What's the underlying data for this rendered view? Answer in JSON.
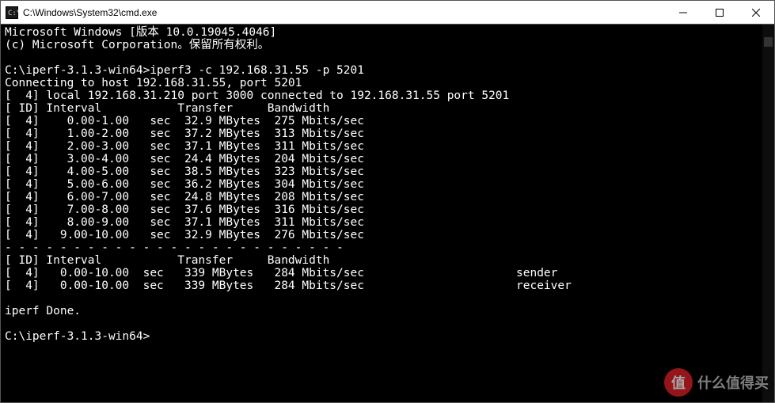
{
  "window": {
    "title": "C:\\Windows\\System32\\cmd.exe",
    "icon": "cmd-icon"
  },
  "terminal": {
    "header_line1": "Microsoft Windows [版本 10.0.19045.4046]",
    "header_line2": "(c) Microsoft Corporation。保留所有权利。",
    "prompt1_path": "C:\\iperf-3.1.3-win64>",
    "prompt1_cmd": "iperf3 -c 192.168.31.55 -p 5201",
    "connecting": "Connecting to host 192.168.31.55, port 5201",
    "local_info": "[  4] local 192.168.31.210 port 3000 connected to 192.168.31.55 port 5201",
    "col_header": "[ ID] Interval           Transfer     Bandwidth",
    "rows": [
      {
        "id": 4,
        "interval": "0.00-1.00",
        "unit": "sec",
        "transfer": "32.9 MBytes",
        "bandwidth": "275 Mbits/sec"
      },
      {
        "id": 4,
        "interval": "1.00-2.00",
        "unit": "sec",
        "transfer": "37.2 MBytes",
        "bandwidth": "313 Mbits/sec"
      },
      {
        "id": 4,
        "interval": "2.00-3.00",
        "unit": "sec",
        "transfer": "37.1 MBytes",
        "bandwidth": "311 Mbits/sec"
      },
      {
        "id": 4,
        "interval": "3.00-4.00",
        "unit": "sec",
        "transfer": "24.4 MBytes",
        "bandwidth": "204 Mbits/sec"
      },
      {
        "id": 4,
        "interval": "4.00-5.00",
        "unit": "sec",
        "transfer": "38.5 MBytes",
        "bandwidth": "323 Mbits/sec"
      },
      {
        "id": 4,
        "interval": "5.00-6.00",
        "unit": "sec",
        "transfer": "36.2 MBytes",
        "bandwidth": "304 Mbits/sec"
      },
      {
        "id": 4,
        "interval": "6.00-7.00",
        "unit": "sec",
        "transfer": "24.8 MBytes",
        "bandwidth": "208 Mbits/sec"
      },
      {
        "id": 4,
        "interval": "7.00-8.00",
        "unit": "sec",
        "transfer": "37.6 MBytes",
        "bandwidth": "316 Mbits/sec"
      },
      {
        "id": 4,
        "interval": "8.00-9.00",
        "unit": "sec",
        "transfer": "37.1 MBytes",
        "bandwidth": "311 Mbits/sec"
      },
      {
        "id": 4,
        "interval": "9.00-10.00",
        "unit": "sec",
        "transfer": "32.9 MBytes",
        "bandwidth": "276 Mbits/sec"
      }
    ],
    "divider": "- - - - - - - - - - - - - - - - - - - - - - - - -",
    "summary_header": "[ ID] Interval           Transfer     Bandwidth",
    "summary_rows": [
      {
        "id": 4,
        "interval": "0.00-10.00",
        "unit": "sec",
        "transfer": "339 MBytes",
        "bandwidth": "284 Mbits/sec",
        "role": "sender"
      },
      {
        "id": 4,
        "interval": "0.00-10.00",
        "unit": "sec",
        "transfer": "339 MBytes",
        "bandwidth": "284 Mbits/sec",
        "role": "receiver"
      }
    ],
    "done": "iperf Done.",
    "prompt2": "C:\\iperf-3.1.3-win64>"
  },
  "watermark": {
    "badge": "值",
    "text": "什么值得买"
  }
}
